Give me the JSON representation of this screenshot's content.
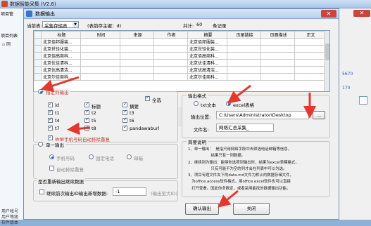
{
  "app": {
    "title": "数据智能采集  (V2.6)",
    "left_tab1": "项目管",
    "left_tab2": "项目列表",
    "tree_item": "▫ 网",
    "bottom_lines": [
      "用户帐号",
      "用户等级",
      "软件版本"
    ],
    "right_value1": "5670",
    "right_value2": "170"
  },
  "dialog": {
    "title": "数据输出",
    "topbar": {
      "table_label": "当前表:",
      "table_value": "采集存储表",
      "table_id": "(表前存主键：d)",
      "total_label": "共计:",
      "total_value": "60",
      "records": "条记录"
    },
    "grid": {
      "columns": [
        "标题",
        "时间",
        "来源",
        "作者",
        "摘要",
        "页尾链接",
        "页面描述",
        "正文"
      ],
      "rows": [
        [
          "北京佰邦服装...",
          "",
          "",
          "",
          "北京佰邦服装...",
          "",
          "",
          ""
        ],
        [
          "北京世铨化装...",
          "",
          "",
          "",
          "北京世铨化装...",
          "",
          "",
          ""
        ],
        [
          "北京佰高商科...",
          "",
          "",
          "",
          "北京佰高商科...",
          "",
          "",
          ""
        ],
        [
          "北京优佳清科...",
          "",
          "",
          "",
          "北京优佳清科...",
          "",
          "",
          ""
        ],
        [
          "北京优高清洁...",
          "",
          "",
          "",
          "北京优高清洁...",
          "",
          "",
          ""
        ],
        [
          "北京尔佳商科...",
          "",
          "",
          "",
          "北京尔佳商科...",
          "",
          "",
          ""
        ]
      ]
    },
    "output_fields": {
      "legend": "指定列输出",
      "select_all": "全选",
      "items": [
        {
          "label": "id",
          "checked": true
        },
        {
          "label": "标题",
          "checked": true
        },
        {
          "label": "摘要",
          "checked": true
        },
        {
          "label": "t1",
          "checked": true
        },
        {
          "label": "t2",
          "checked": true
        },
        {
          "label": "t3",
          "checked": true
        },
        {
          "label": "t4",
          "checked": true
        },
        {
          "label": "t5",
          "checked": true
        },
        {
          "label": "t6",
          "checked": true
        },
        {
          "label": "t7",
          "checked": true
        },
        {
          "label": "t8",
          "checked": true
        },
        {
          "label": "pandawaburl",
          "checked": true
        }
      ],
      "dedupe_label": "依据手机号码自动排除重复"
    },
    "single_output": {
      "legend": "单一输出",
      "options": [
        "手机号码",
        "固定电话",
        "邮箱"
      ],
      "auto_dedupe": "自动排除重复"
    },
    "resume": {
      "legend": "是否重新输出继续数据",
      "checkbox_label": "继续前次输出ID输出新增数据:",
      "value": "-1",
      "hint": "(输出至大ID)"
    },
    "format": {
      "legend": "输出格式",
      "option_txt": "txt文本",
      "option_excel": "excel表格",
      "selected": "excel表格",
      "location_label": "输出位置:",
      "location_value": "C:\\Users\\Administrator\\Desktop",
      "browse_label": "...",
      "filename_label": "文件名:",
      "filename_value": "网络汇总采集_"
    },
    "help": {
      "legend": "简要说明",
      "lines": [
        "1、单一输出：  是指只用网络字段中去筛选电话邮箱等信息，",
        "                   结果只有一列数据。",
        "2、继续到为输出：能够你选项到输出时，结果为excel表模格式，",
        "                   只有可能不为空的列才会在列表中可以为选。",
        "3、项目专题文件夹下的data.md文件为默认的数据存储文件，",
        "   为office.access软件格式，用office.excel软件也可以直接",
        "   打开查看。因此你多数定，或者采用能找的数据输出功能。"
      ]
    },
    "buttons": {
      "confirm": "确认输出",
      "close": "关闭"
    }
  },
  "colors": {
    "arrow": "#e3382f",
    "title_bar": "#b8d0ee",
    "panel": "#f0f0f0"
  }
}
